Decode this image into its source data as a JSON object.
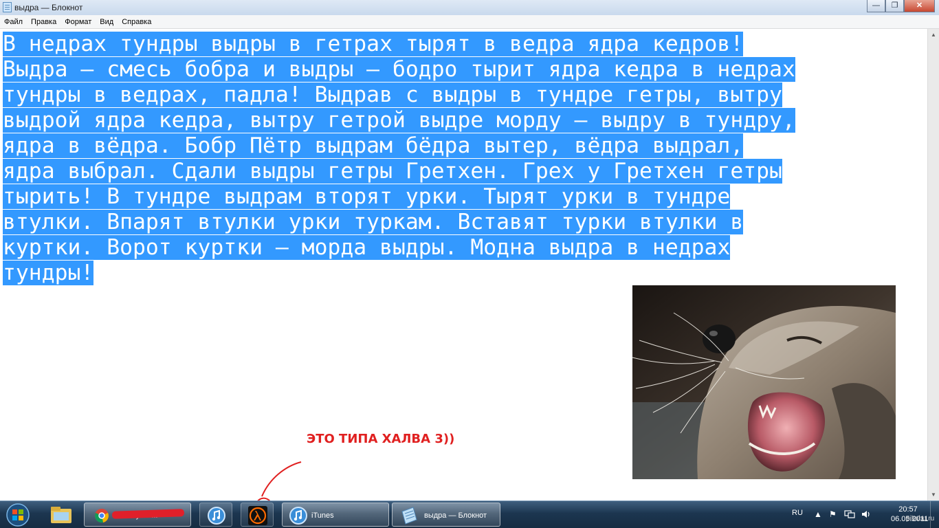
{
  "window": {
    "title": "выдра — Блокнот",
    "buttons": {
      "minimize": "—",
      "maximize": "❐",
      "close": "✕"
    }
  },
  "menu": [
    "Файл",
    "Правка",
    "Формат",
    "Вид",
    "Справка"
  ],
  "editor": {
    "lines": [
      "В недрах тундры выдры в гетрах тырят в ведра ядра кедров!",
      "Выдра — смесь бобра и выдры — бодро тырит ядра кедра в недрах",
      "тундры в ведрах, падла! Выдрав с выдры в тундре гетры, вытру",
      "выдрой ядра кедра, вытру гетрой выдре морду — выдру в тундру,",
      "ядра в вёдра. Бобр Пётр выдрам бёдра вытер, вёдра выдрал,",
      "ядра выбрал. Сдали выдры гетры Гретхен. Грех у Гретхен гетры",
      "тырить! В тундре выдрам вторят урки. Тырят урки в тундре",
      "втулки. Впарят втулки урки туркам. Вставят турки втулки в",
      "куртки. Ворот куртки — морда выдры. Модна выдра в недрах",
      "тундры!"
    ],
    "selection_color": "#3399ff"
  },
  "annotation": {
    "text": "ЭТО ТИПА ХАЛВА 3))",
    "color": "#e02020"
  },
  "taskbar": {
    "buttons": [
      {
        "label": "Pикабу — ...",
        "icon": "chrome-icon",
        "active": true
      },
      {
        "label": "",
        "icon": "itunes-icon",
        "active": false
      },
      {
        "label": "",
        "icon": "half-life-icon",
        "active": false
      },
      {
        "label": "iTunes",
        "icon": "itunes-icon",
        "active": true
      },
      {
        "label": "выдра — Блокнот",
        "icon": "notepad-icon",
        "active": true
      }
    ],
    "tray": {
      "language": "RU",
      "time": "20:57",
      "date": "06.05.2011"
    }
  },
  "watermark": "pikabu.ru"
}
